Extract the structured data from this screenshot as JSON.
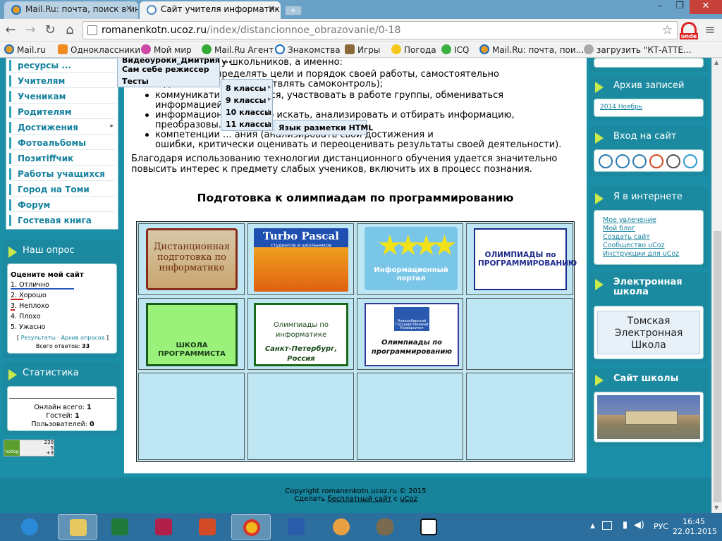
{
  "browser": {
    "tabs": [
      {
        "title": "Mail.Ru: почта, поиск в ин",
        "active": false
      },
      {
        "title": "Сайт учителя информатик",
        "active": true
      }
    ],
    "url_host": "romanenkotn.ucoz.ru",
    "url_path": "/index/distancionnoe_obrazovanie/0-18",
    "extension_label": "unde",
    "bookmarks": [
      "Mail.ru",
      "Одноклассники",
      "Мой мир",
      "Mail.Ru Агент",
      "Знакомства",
      "Игры",
      "Погода",
      "ICQ",
      "Mail.Ru: почта, пои...",
      "загрузить \"КТ-АТТЕ..."
    ]
  },
  "nav": {
    "items": [
      "ресурсы ...",
      "Учителям",
      "Ученикам",
      "Родителям",
      "Достижения",
      "Фотоальбомы",
      "Позитiffчик",
      "Работы учащихся",
      "Город на Томи",
      "Форум",
      "Гостевая книга"
    ]
  },
  "dropdown": {
    "level1": [
      "Видеоуроки_Дмитрия ...",
      "Сам себе режиссер",
      "Тесты"
    ],
    "level2": [
      "8 классы",
      "9 классы",
      "10 классы",
      "11 классы"
    ],
    "level3": [
      "Язык разметки HTML"
    ]
  },
  "poll": {
    "title": "Наш опрос",
    "question": "Оцените мой сайт",
    "options": [
      "1. Отлично",
      "2. Хорошо",
      "3. Неплохо",
      "4. Плохо",
      "5. Ужасно"
    ],
    "results_link": "Результаты",
    "archive_link": "Архив опросов",
    "total_label": "Всего ответов:",
    "total_value": "33"
  },
  "stats": {
    "title": "Статистика",
    "online_label": "Онлайн всего:",
    "online_value": "1",
    "guests_label": "Гостей:",
    "guests_value": "1",
    "users_label": "Пользователей:",
    "users_value": "0",
    "counter_lines": [
      "230",
      "5",
      "+3"
    ],
    "counter_brand": "hotlog"
  },
  "content": {
    "top_fragment": "компетенции у школьников, а именно:",
    "bullets": [
      "...тельной (определять цели и порядок своей работы, самостоятельно",
      "...деятельность, осуществлять самоконтроль);",
      "коммуникативн... учиться, участвовать в работе группы, обмениваться",
      "информацией...",
      "информацион... ательно искать, анализировать и отбирать информацию,",
      "преобразовы...",
      "компетенции ... ания (анализировать свои достижения и",
      "ошибки, критически оценивать и переоценивать результаты своей деятельности)."
    ],
    "paragraph": "Благодаря использованию технологии дистанционного обучения удается значительно повысить интерес к предмету слабых учеников, включить их в процесс познания.",
    "olymp_title": "Подготовка к олимпиадам по программированию",
    "banners": {
      "b1": "Дистанционная подготовка по информатике",
      "b2_title": "Turbo Pascal",
      "b2_sub": "студентов и школьников",
      "b3": "Информационный портал",
      "b4": "ОЛИМПИАДЫ по ПРОГРАММИРОВАНИЮ",
      "b5": "ШКОЛА ПРОГРАММИСТА",
      "b6_title": "Олимпиады по информатике",
      "b6_city": "Санкт-Петербург, Россия",
      "b7_univ": "Новосибирский Государственный Университет",
      "b7_title": "Олимпиады по программированию"
    }
  },
  "right": {
    "archive_title": "Архив записей",
    "archive_item": "2014 Ноябрь",
    "login_title": "Вход на сайт",
    "internet_title": "Я в интернете",
    "internet_links": [
      "Мое увлечение",
      "Мой блог",
      "Создать сайт",
      "Сообщество uCoz",
      "Инструкции для uCoz"
    ],
    "eschool_title": "Электронная школа",
    "eschool_banner": "Томская Электронная Школа",
    "school_title": "Сайт школы"
  },
  "footer": {
    "copyright": "Copyright romanenkotn.ucoz.ru © 2015",
    "made_prefix": "Сделать",
    "made_link": "бесплатный сайт",
    "made_mid": "с",
    "made_brand": "uCoz"
  },
  "taskbar": {
    "lang": "РУС",
    "time": "16:45",
    "date": "22.01.2015"
  }
}
